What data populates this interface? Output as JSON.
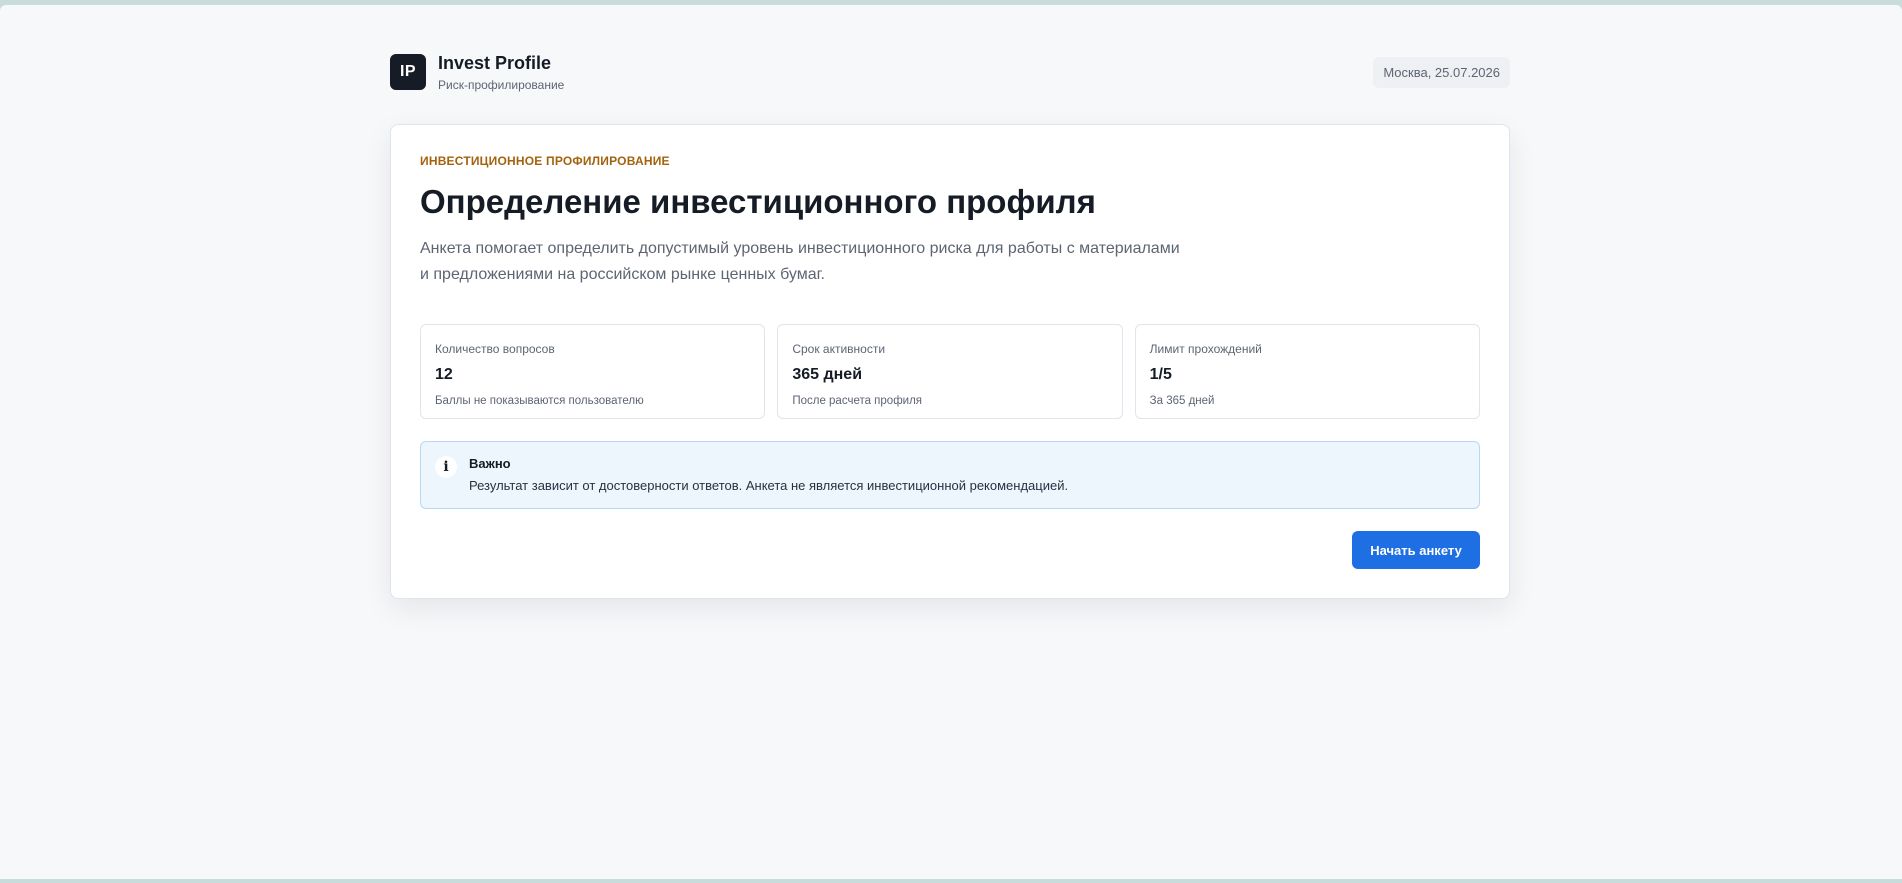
{
  "header": {
    "logo_text": "IP",
    "title": "Invest Profile",
    "subtitle": "Риск-профилирование",
    "date": "Москва, 25.07.2026"
  },
  "card": {
    "eyebrow": "Инвестиционное профилирование",
    "title": "Определение инвестиционного профиля",
    "description_line1": "Анкета помогает определить допустимый уровень инвестиционного риска для работы с материалами",
    "description_line2": "и предложениями на российском рынке ценных бумаг.",
    "stats": [
      {
        "label": "Количество вопросов",
        "value": "12",
        "note": "Баллы не показываются пользователю"
      },
      {
        "label": "Срок активности",
        "value": "365 дней",
        "note": "После расчета профиля"
      },
      {
        "label": "Лимит прохождений",
        "value": "1/5",
        "note": "За 365 дней"
      }
    ],
    "notice": {
      "icon": "info-icon",
      "title": "Важно",
      "text": "Результат зависит от достоверности ответов. Анкета не является инвестиционной рекомендацией."
    },
    "start_button": "Начать анкету"
  },
  "colors": {
    "accent": "#1f6fe4",
    "eyebrow": "#a4620d",
    "notice_bg": "#edf5fd",
    "logo_bg": "#151c26"
  }
}
